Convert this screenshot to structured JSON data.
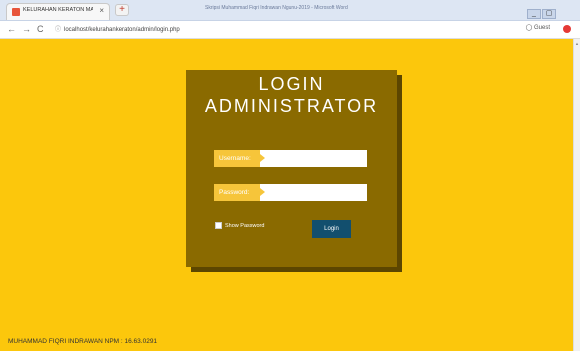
{
  "browser": {
    "tab_title": "KELURAHAN KERATON MARTAP",
    "tab_close": "×",
    "new_tab": "+",
    "window_title": "Skripsi Muhammad Fiqri Indrawan Ngunu-2019 - Microsoft Word",
    "window_controls": [
      "_",
      "▢",
      "×"
    ],
    "nav": {
      "back": "←",
      "forward": "→",
      "reload": "C"
    },
    "address_info": "ⓘ",
    "url": "localhost/kelurahankeraton/admin/login.php",
    "profile_label": "Guest",
    "profile_icon": "user-circle-icon"
  },
  "login": {
    "title_line1": "LOGIN",
    "title_line2": "ADMINISTRATOR",
    "username_label": "Username:",
    "username_value": "",
    "password_label": "Password:",
    "password_value": "",
    "show_password_label": "Show Password",
    "login_button": "Login"
  },
  "footer": {
    "text": "MUHAMMAD FIQRI INDRAWAN NPM : 16.63.0291"
  },
  "colors": {
    "background": "#fcc70c",
    "panel": "#8a6a00",
    "label": "#f6c53a",
    "button": "#124f6e"
  }
}
